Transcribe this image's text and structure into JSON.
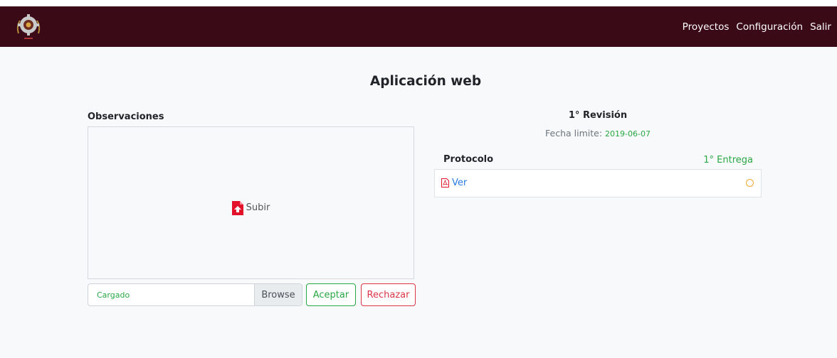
{
  "nav": {
    "links": [
      "Proyectos",
      "Configuración",
      "Salir"
    ]
  },
  "page": {
    "title": "Aplicación web"
  },
  "observations": {
    "label": "Observaciones",
    "upload_text": "Subir",
    "file_status": "Cargado",
    "browse_label": "Browse",
    "accept_label": "Aceptar",
    "reject_label": "Rechazar"
  },
  "review": {
    "title": "1° Revisión",
    "deadline_label": "Fecha limite:",
    "deadline_date": "2019-06-07",
    "protocol_label": "Protocolo",
    "delivery_label": "1° Entrega",
    "view_label": "Ver"
  },
  "colors": {
    "navbar": "#3b0a17",
    "success": "#28a745",
    "danger": "#dc3545",
    "link": "#2a7ae2",
    "pending": "#f0a832"
  },
  "icons": {
    "logo": "gear-logo-icon",
    "upload": "file-upload-icon",
    "pdf": "pdf-file-icon",
    "status": "pending-circle-icon"
  }
}
